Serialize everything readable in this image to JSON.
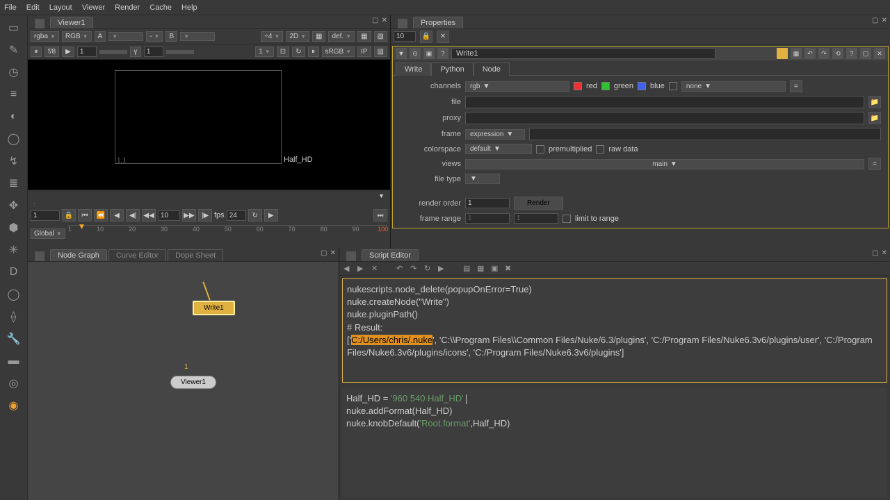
{
  "menu": {
    "items": [
      "File",
      "Edit",
      "Layout",
      "Viewer",
      "Render",
      "Cache",
      "Help"
    ]
  },
  "left_tools": [
    "▭",
    "✎",
    "◷",
    "≡",
    "◐",
    "◯",
    "↯",
    "≣",
    "✥",
    "⬢",
    "✳",
    "D",
    "◯",
    "⟠",
    "🔧",
    "▬",
    "◎",
    "◉"
  ],
  "viewer": {
    "tab": "Viewer1",
    "bar1": {
      "chan": "rgba",
      "cspace": "RGB",
      "a": "A",
      "dash": "-",
      "b": "B",
      "div": "÷4",
      "dim": "2D",
      "def": "def."
    },
    "bar2": {
      "fstop": "f/8",
      "gain": "1",
      "gamma_lbl": "γ",
      "gamma": "1",
      "zoom": "1",
      "srgb": "sRGB",
      "ip": "IP"
    },
    "coords": "1,1",
    "format": "Half_HD",
    "timeline": {
      "start": "1",
      "cur": "10",
      "fps_lbl": "fps",
      "fps": "24",
      "mode": "Global",
      "ticks": [
        "1",
        "10",
        "20",
        "30",
        "40",
        "50",
        "60",
        "70",
        "80",
        "90",
        "100"
      ],
      "end": "100"
    }
  },
  "properties": {
    "tab": "Properties",
    "count": "10",
    "node": {
      "name": "Write1",
      "tabs": [
        "Write",
        "Python",
        "Node"
      ],
      "channels_lbl": "channels",
      "channels": "rgb",
      "red": "red",
      "green": "green",
      "blue": "blue",
      "none": "none",
      "file_lbl": "file",
      "proxy_lbl": "proxy",
      "frame_lbl": "frame",
      "frame": "expression",
      "colorspace_lbl": "colorspace",
      "colorspace": "default",
      "premult": "premultiplied",
      "raw": "raw data",
      "views_lbl": "views",
      "views": "main",
      "filetype_lbl": "file type",
      "render_order_lbl": "render order",
      "render_order": "1",
      "render_btn": "Render",
      "frame_range_lbl": "frame range",
      "fr1": "1",
      "fr2": "1",
      "limit": "limit to range"
    }
  },
  "nodegraph": {
    "tabs": [
      "Node Graph",
      "Curve Editor",
      "Dope Sheet"
    ],
    "write": "Write1",
    "viewer": "Viewer1",
    "one": "1"
  },
  "script": {
    "tab": "Script Editor",
    "out_lines": [
      "nukescripts.node_delete(popupOnError=True)",
      "nuke.createNode(\"Write\")",
      "nuke.pluginPath()",
      "# Result:"
    ],
    "out_path_pre": "['",
    "out_path_hl": "C:/Users/chris/.nuke",
    "out_path_post": "', 'C:\\\\Program Files\\\\Common Files/Nuke/6.3/plugins', 'C:/Program Files/Nuke6.3v6/plugins/user', 'C:/Program Files/Nuke6.3v6/plugins/icons', 'C:/Program Files/Nuke6.3v6/plugins']",
    "in_l1a": "Half_HD = ",
    "in_l1b": "'960 540 Half_HD'",
    "in_l2": "nuke.addFormat(Half_HD)",
    "in_l3a": "nuke.knobDefault(",
    "in_l3b": "'Root.format'",
    "in_l3c": ",Half_HD)"
  }
}
